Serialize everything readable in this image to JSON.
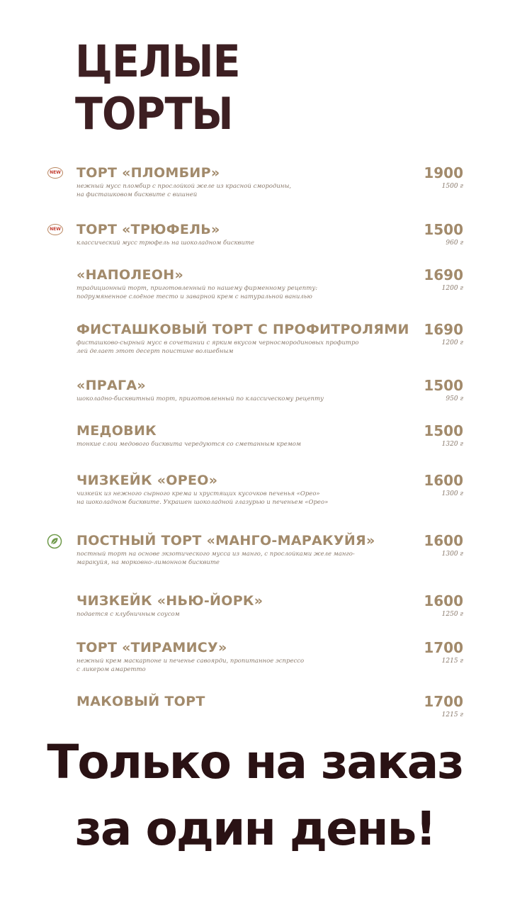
{
  "title": {
    "line1": "ЦЕЛЫЕ",
    "line2": "ТОРТЫ"
  },
  "badge_new": "NEW",
  "items": [
    {
      "name": "ТОРТ «ПЛОМБИР»",
      "desc1": "нежный мусс пломбир с прослойкой желе из красной смородины,",
      "desc2": "на фисташковом бисквите с вишней",
      "price": "1900",
      "weight": "1500 г",
      "badge": "new-icon"
    },
    {
      "name": "ТОРТ «ТРЮФЕЛЬ»",
      "desc1": "классический мусс трюфель на шоколадном бисквите",
      "desc2": "",
      "price": "1500",
      "weight": "960 г",
      "badge": "new-icon"
    },
    {
      "name": "«НАПОЛЕОН»",
      "desc1": "традиционный торт, приготовленный по нашему фирменному рецепту:",
      "desc2": "подрумяненное слоёное тесто и заварной крем с натуральной ванилью",
      "price": "1690",
      "weight": "1200 г",
      "badge": ""
    },
    {
      "name": "ФИСТАШКОВЫЙ ТОРТ С ПРОФИТРОЛЯМИ",
      "desc1": "фисташково-сырный мусс в сочетании с ярким вкусом черносмородиновых профитро",
      "desc2": "лей делает этот десерт поистине волшебным",
      "price": "1690",
      "weight": "1200 г",
      "badge": ""
    },
    {
      "name": "«ПРАГА»",
      "desc1": "шоколадно-бисквитный торт, приготовленный по классическому рецепту",
      "desc2": "",
      "price": "1500",
      "weight": "950 г",
      "badge": ""
    },
    {
      "name": "МЕДОВИК",
      "desc1": "тонкие слои медового бисквита чередуются со сметанным кремом",
      "desc2": "",
      "price": "1500",
      "weight": "1320 г",
      "badge": ""
    },
    {
      "name": "ЧИЗКЕЙК «ОРЕО»",
      "desc1": "чизкейк из нежного сырного крема и хрустящих кусочков печенья «Орео»",
      "desc2": "на шоколадном бисквите. Украшен шоколадной глазурью и печеньем «Орео»",
      "price": "1600",
      "weight": "1300 г",
      "badge": ""
    },
    {
      "name": "ПОСТНЫЙ ТОРТ «МАНГО-МАРАКУЙЯ»",
      "desc1": "постный торт на основе экзотического мусса из манго, с прослойками желе манго-",
      "desc2": "маракуйя, на морковно-лимонном бисквите",
      "price": "1600",
      "weight": "1300 г",
      "badge": "leaf-icon"
    },
    {
      "name": "ЧИЗКЕЙК «НЬЮ-ЙОРК»",
      "desc1": "подается с клубничным соусом",
      "desc2": "",
      "price": "1600",
      "weight": "1250 г",
      "badge": ""
    },
    {
      "name": "ТОРТ «ТИРАМИСУ»",
      "desc1": "нежный крем маскарпоне и печенье савоярди, пропитанное эспрессо",
      "desc2": "с ликером амаретто",
      "price": "1700",
      "weight": "1215 г",
      "badge": ""
    },
    {
      "name": "МАКОВЫЙ ТОРТ",
      "desc1": "",
      "desc2": "",
      "price": "1700",
      "weight": "1215 г",
      "badge": ""
    }
  ],
  "footer": {
    "line1": "Только на заказ",
    "line2": "за один день!"
  },
  "colors": {
    "title": "#3d1f22",
    "item_text": "#a28a6b",
    "desc_text": "#8a7a6c",
    "footer": "#2a1214",
    "badge_border": "#b9865f",
    "badge_text": "#c23b2e",
    "leaf": "#6f9a4a"
  }
}
